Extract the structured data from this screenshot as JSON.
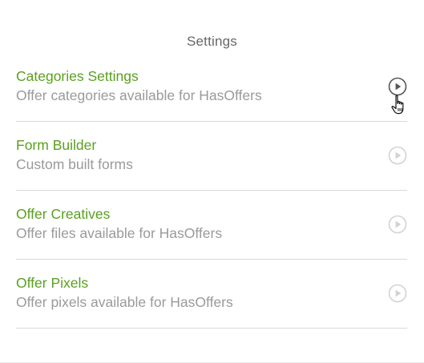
{
  "panel": {
    "title": "Settings"
  },
  "items": [
    {
      "title": "Categories Settings",
      "description": "Offer categories available for HasOffers",
      "active": true
    },
    {
      "title": "Form Builder",
      "description": "Custom built forms",
      "active": false
    },
    {
      "title": "Offer Creatives",
      "description": "Offer files available for HasOffers",
      "active": false
    },
    {
      "title": "Offer Pixels",
      "description": "Offer pixels available for HasOffers",
      "active": false
    }
  ],
  "icons": {
    "item_action": "play-circle-icon",
    "pointer": "hand-pointer-icon"
  },
  "colors": {
    "title_green": "#5a9f1e",
    "description_gray": "#9a9a9a",
    "icon_active": "#555555",
    "icon_inactive": "#cfcfcf",
    "divider": "#d9d9d9"
  }
}
